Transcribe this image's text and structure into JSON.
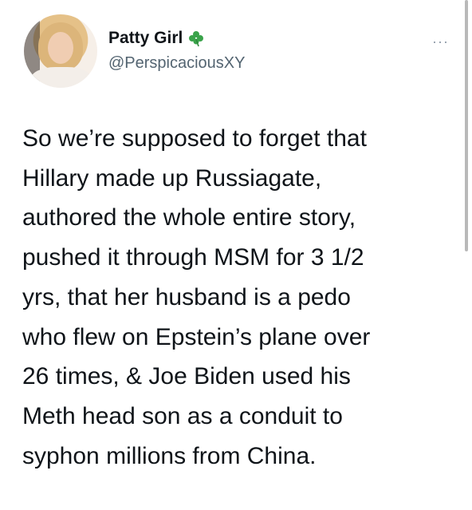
{
  "author": {
    "display_name": "Patty Girl",
    "handle": "@PerspicaciousXY",
    "badge_icon": "shamrock-icon",
    "avatar_icon": "profile-photo"
  },
  "menu": {
    "more_label": "···",
    "icon": "more-dots-icon"
  },
  "tweet": {
    "lines": [
      "So we’re supposed to forget that",
      "Hillary made up Russiagate,",
      "authored the whole entire story,",
      "pushed it through MSM for 3 1/2",
      "yrs, that her husband is a pedo",
      "who flew on Epstein’s plane over",
      "26 times, & Joe Biden used his",
      "Meth head son as a conduit to",
      "syphon millions from China."
    ]
  },
  "colors": {
    "text": "#0f1419",
    "secondary": "#536471",
    "clover": "#3aa34a"
  }
}
